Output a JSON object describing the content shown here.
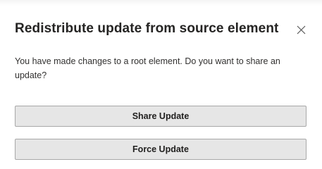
{
  "dialog": {
    "title": "Redistribute update from source element",
    "message": "You have made changes to a root element. Do you want to share an update?",
    "close_icon": "close-icon",
    "buttons": {
      "share_label": "Share Update",
      "force_label": "Force Update"
    }
  }
}
